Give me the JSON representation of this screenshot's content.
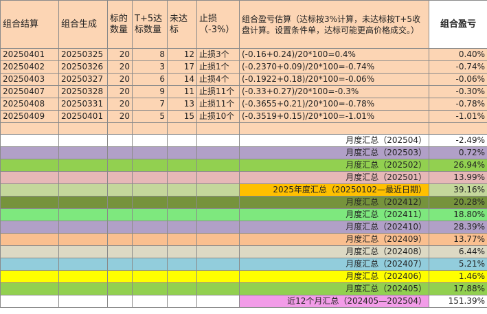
{
  "headers": {
    "col1": "组合结算",
    "col2": "组合生成",
    "col3": "标的数量",
    "col4": "T+5达标数量",
    "col5": "未达标",
    "col6": "止损（-3%）",
    "col7": "组合盈亏估算（达标按3%计算，未达标按T+5收盘计算。设置条件单，达标可能更高价格成交。）",
    "col8": "组合盈亏"
  },
  "rows": [
    {
      "settle": "20250401",
      "gen": "20250325",
      "count": "20",
      "hit": "8",
      "miss": "12",
      "stop": "止损3个",
      "calc": "(-0.16+0.24)/20*100=0.4%",
      "pnl": "0.40%"
    },
    {
      "settle": "20250402",
      "gen": "20250326",
      "count": "20",
      "hit": "3",
      "miss": "17",
      "stop": "止损1个",
      "calc": "(-0.2370+0.09)/20*100=-0.74%",
      "pnl": "-0.74%"
    },
    {
      "settle": "20250403",
      "gen": "20250327",
      "count": "20",
      "hit": "6",
      "miss": "14",
      "stop": "止损4个",
      "calc": "(-0.1922+0.18)/20*100=-0.06%",
      "pnl": "-0.06%"
    },
    {
      "settle": "20250407",
      "gen": "20250328",
      "count": "20",
      "hit": "9",
      "miss": "11",
      "stop": "止损11个",
      "calc": "(-0.33+0.27)/20*100=-0.3%",
      "pnl": "-0.30%"
    },
    {
      "settle": "20250408",
      "gen": "20250331",
      "count": "20",
      "hit": "7",
      "miss": "13",
      "stop": "止损11个",
      "calc": "(-0.3655+0.21)/20*100=-0.78%",
      "pnl": "-0.78%"
    },
    {
      "settle": "20250409",
      "gen": "20250401",
      "count": "20",
      "hit": "5",
      "miss": "15",
      "stop": "止损10个",
      "calc": "(-0.3519+0.15)/20*100=-1.01%",
      "pnl": "-1.01%"
    }
  ],
  "summaries": [
    {
      "label": "月度汇总（202504）",
      "value": "-2.49%",
      "color": "#ffffff"
    },
    {
      "label": "月度汇总（202503）",
      "value": "0.72%",
      "color": "#b1a0c7"
    },
    {
      "label": "月度汇总（202502）",
      "value": "26.94%",
      "color": "#92d050"
    },
    {
      "label": "月度汇总（202501）",
      "value": "13.99%",
      "color": "#e6b8b7"
    },
    {
      "label": "2025年度汇总（20250102—最近日期）",
      "value": "39.16%",
      "color": "#c4d79b",
      "labelColor": "#ffc000"
    },
    {
      "label": "月度汇总（202412）",
      "value": "20.28%",
      "color": "#76933c"
    },
    {
      "label": "月度汇总（202411）",
      "value": "18.80%",
      "color": "#7ee87e"
    },
    {
      "label": "月度汇总（202410）",
      "value": "28.39%",
      "color": "#b1a0c7"
    },
    {
      "label": "月度汇总（202409）",
      "value": "13.77%",
      "color": "#fabf8f"
    },
    {
      "label": "月度汇总（202408）",
      "value": "6.44%",
      "color": "#ddd9c4"
    },
    {
      "label": "月度汇总（202407）",
      "value": "5.21%",
      "color": "#92cddc"
    },
    {
      "label": "月度汇总（202406）",
      "value": "1.46%",
      "color": "#ffff00"
    },
    {
      "label": "月度汇总（202405）",
      "value": "17.88%",
      "color": "#92d050"
    },
    {
      "label": "近12个月汇总（202405—202504）",
      "value": "151.39%",
      "color": "#ffffff",
      "labelColor": "#f29ce8"
    }
  ]
}
